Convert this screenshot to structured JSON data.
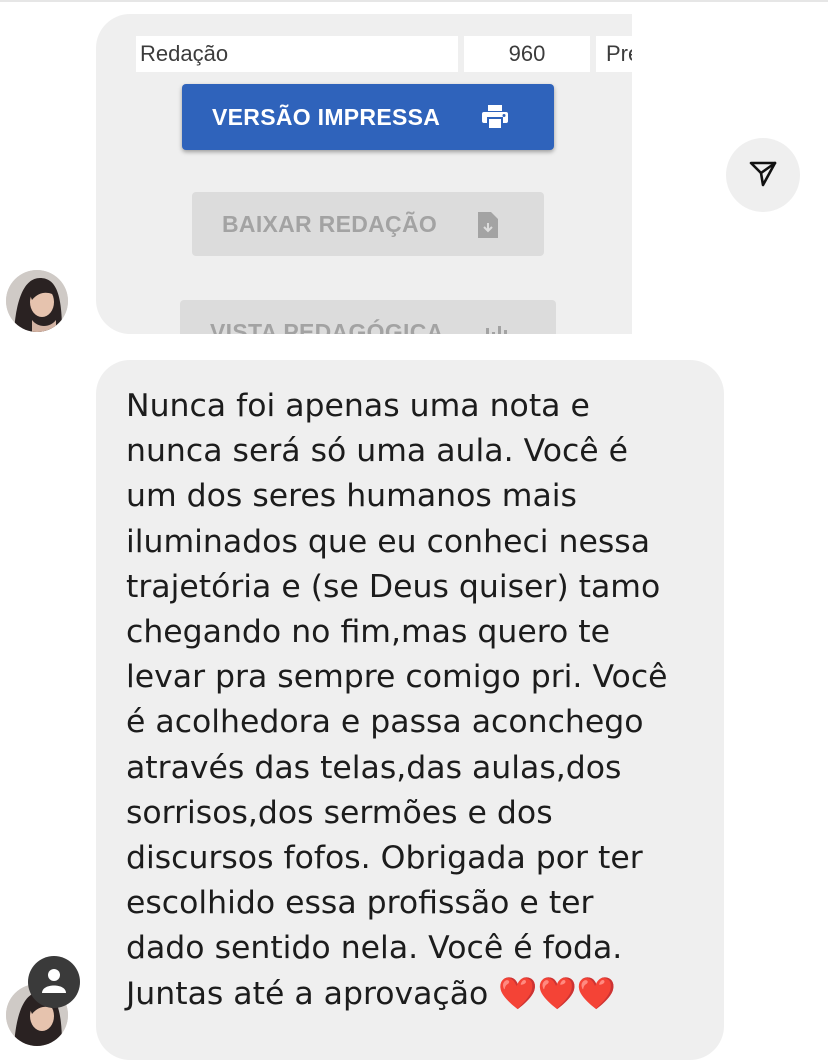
{
  "shared_post": {
    "row": {
      "label": "Redação",
      "score": "960",
      "status": "Presente"
    },
    "print_button_label": "VERSÃO IMPRESSA",
    "download_button_label": "BAIXAR REDAÇÃO",
    "vista_button_label": "VISTA PEDAGÓGICA",
    "print_color": "#2f63bb"
  },
  "message": {
    "text": "Nunca foi apenas uma nota e\nnunca será só uma aula. Você é\num dos seres humanos mais\niluminados que eu conheci nessa\ntrajetória e (se Deus quiser) tamo\nchegando no fim,mas quero te\nlevar pra sempre comigo pri. Você\né acolhedora e passa aconchego\natravés das telas,das aulas,dos\nsorrisos,dos sermões e dos\ndiscursos fofos. Obrigada por ter\nescolhido essa profissão e ter\ndado sentido nela. Você é foda.\nJuntas até a aprovação ❤️❤️❤️"
  },
  "icons": {
    "send": "send-icon",
    "printer": "printer-icon",
    "download": "file-download-icon",
    "chart": "bar-chart-icon",
    "user": "user-icon"
  }
}
